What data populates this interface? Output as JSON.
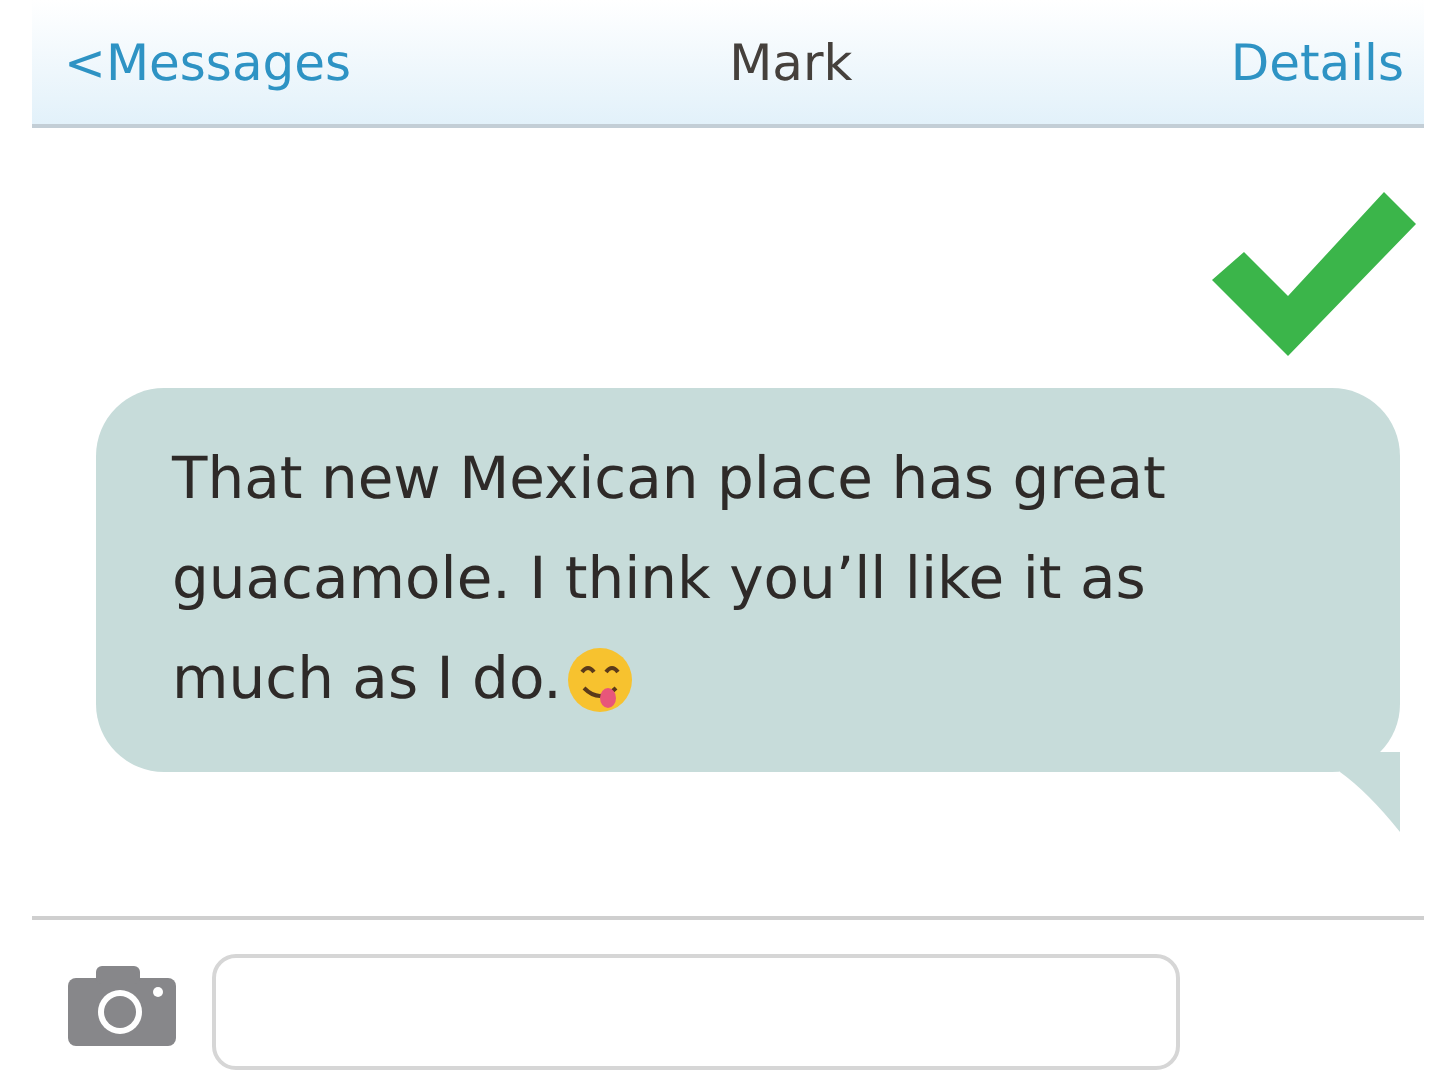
{
  "nav": {
    "back": "<Messages",
    "title": "Mark",
    "action": "Details"
  },
  "messages": [
    {
      "text": "That new Mexican place has great guacamole. I think you’ll like it as much as I do.",
      "emoji": true,
      "sent": true
    }
  ],
  "composer": {
    "kind": "text"
  }
}
